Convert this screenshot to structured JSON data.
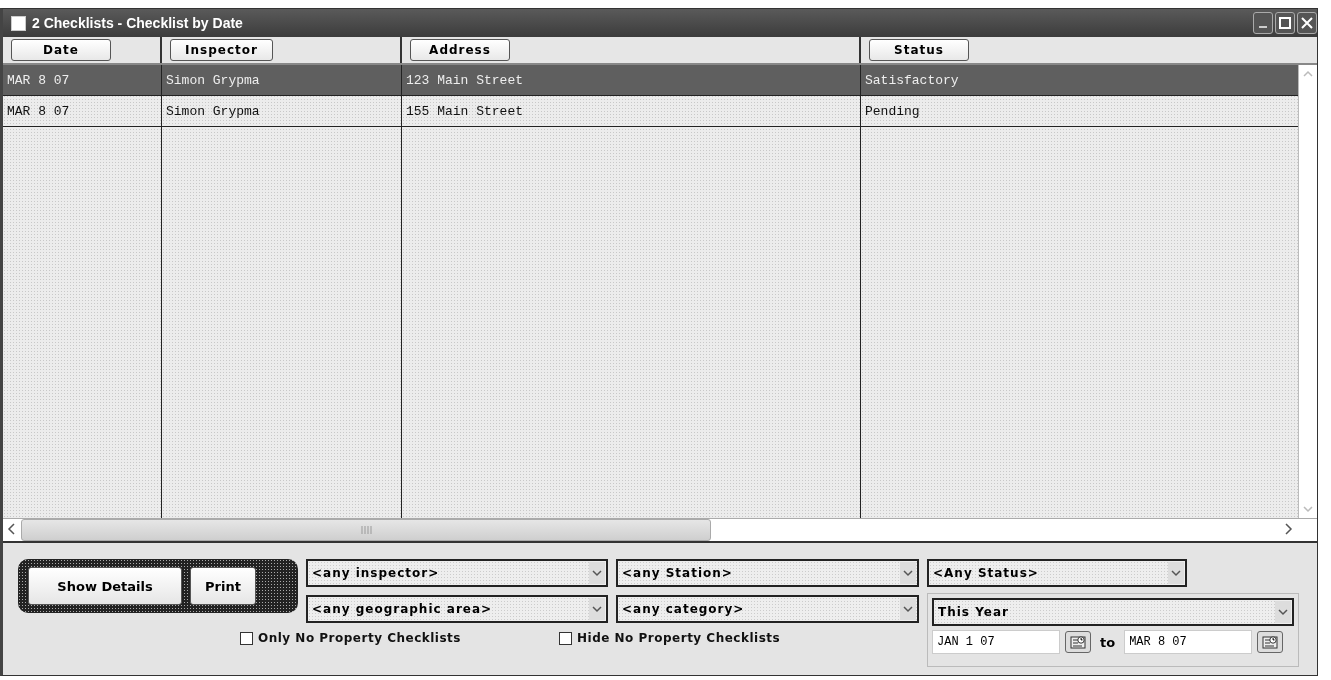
{
  "window": {
    "title": "2 Checklists - Checklist by Date"
  },
  "table": {
    "columns": [
      {
        "label": "Date"
      },
      {
        "label": "Inspector"
      },
      {
        "label": "Address"
      },
      {
        "label": "Status"
      }
    ],
    "rows": [
      {
        "cells": [
          "MAR 8 07",
          "Simon Grypma",
          "123 Main Street",
          "Satisfactory"
        ],
        "selected": true
      },
      {
        "cells": [
          "MAR 8 07",
          "Simon Grypma",
          "155 Main Street",
          "Pending"
        ],
        "selected": false
      }
    ]
  },
  "actions": [
    "Show Details",
    "Print"
  ],
  "filters": [
    {
      "value": "<any inspector>"
    },
    {
      "value": "<any Station>"
    },
    {
      "value": "<any geographic area>"
    },
    {
      "value": "<any category>"
    }
  ],
  "status_filter": {
    "value": "<Any Status>"
  },
  "checkboxes": [
    {
      "label": "Only No Property Checklists",
      "checked": false
    },
    {
      "label": "Hide No Property Checklists",
      "checked": false
    }
  ],
  "date_range": {
    "period": "This Year",
    "from": "JAN 1 07",
    "separator": "to",
    "to": "MAR 8 07"
  }
}
